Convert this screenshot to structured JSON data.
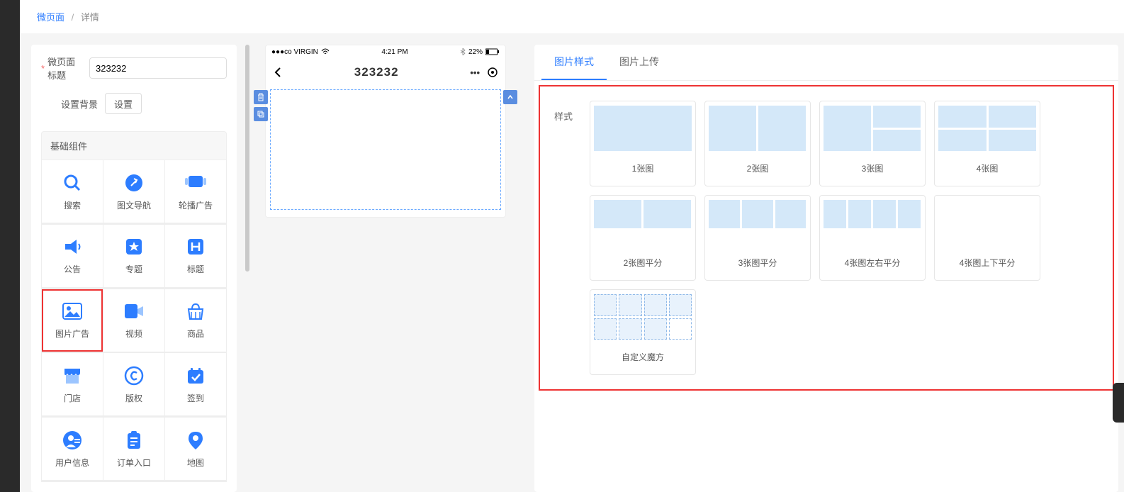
{
  "breadcrumb": {
    "root": "微页面",
    "current": "详情"
  },
  "form": {
    "title_label": "微页面标题",
    "title_value": "323232",
    "bg_label": "设置背景",
    "bg_button": "设置"
  },
  "section_title": "基础组件",
  "components": [
    {
      "id": "search",
      "name": "搜索"
    },
    {
      "id": "imgnav",
      "name": "图文导航"
    },
    {
      "id": "carousel",
      "name": "轮播广告"
    },
    {
      "id": "notice",
      "name": "公告"
    },
    {
      "id": "topic",
      "name": "专题"
    },
    {
      "id": "heading",
      "name": "标题"
    },
    {
      "id": "imgad",
      "name": "图片广告"
    },
    {
      "id": "video",
      "name": "视频"
    },
    {
      "id": "goods",
      "name": "商品"
    },
    {
      "id": "store",
      "name": "门店"
    },
    {
      "id": "copyright",
      "name": "版权"
    },
    {
      "id": "checkin",
      "name": "签到"
    },
    {
      "id": "userinfo",
      "name": "用户信息"
    },
    {
      "id": "order",
      "name": "订单入口"
    },
    {
      "id": "map",
      "name": "地图"
    }
  ],
  "selected_component": "imgad",
  "preview": {
    "carrier": "●●●co VIRGIN",
    "time": "4:21 PM",
    "battery": "22%",
    "title": "323232"
  },
  "config": {
    "tabs": [
      {
        "id": "style",
        "label": "图片样式"
      },
      {
        "id": "upload",
        "label": "图片上传"
      }
    ],
    "active_tab": "style",
    "field_label": "样式",
    "styles": [
      {
        "id": "s1",
        "name": "1张图"
      },
      {
        "id": "s2",
        "name": "2张图"
      },
      {
        "id": "s3",
        "name": "3张图"
      },
      {
        "id": "s4",
        "name": "4张图"
      },
      {
        "id": "s2avg",
        "name": "2张图平分"
      },
      {
        "id": "s3avg",
        "name": "3张图平分"
      },
      {
        "id": "s4lr",
        "name": "4张图左右平分"
      },
      {
        "id": "s4tb",
        "name": "4张图上下平分"
      },
      {
        "id": "custom",
        "name": "自定义魔方"
      }
    ]
  }
}
